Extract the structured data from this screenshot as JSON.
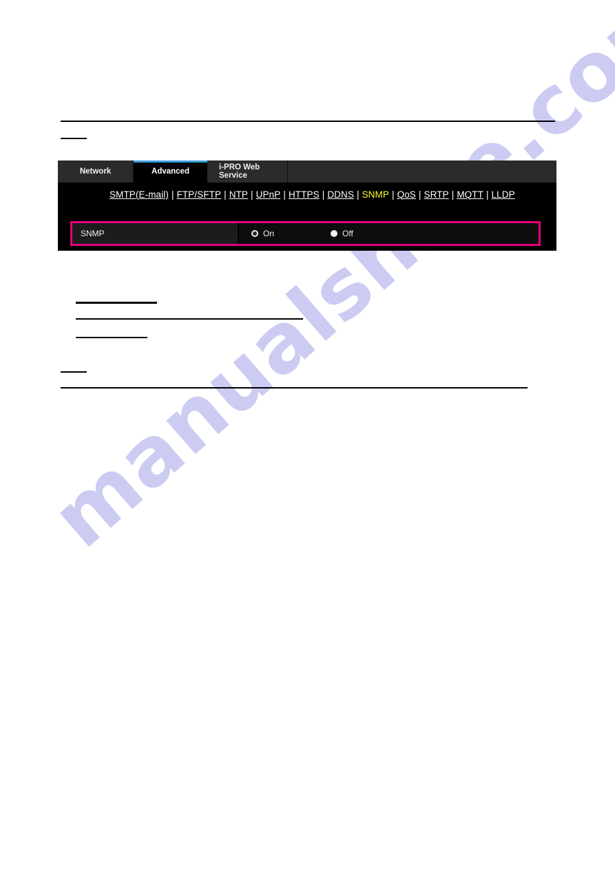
{
  "document": {
    "background": "#ffffff",
    "watermark": "manualshive.com",
    "watermark_color": "#ccccf2"
  },
  "panel": {
    "background": "#000000",
    "accent_active_tab": "#3a9fe0",
    "highlight_color": "#e6007e",
    "tabs": [
      {
        "label": "Network",
        "active": false
      },
      {
        "label": "Advanced",
        "active": true
      },
      {
        "label": "i-PRO Web Service",
        "active": false
      }
    ],
    "subnav": {
      "separator": "|",
      "links": [
        {
          "label": "SMTP(E-mail)",
          "current": false
        },
        {
          "label": "FTP/SFTP",
          "current": false
        },
        {
          "label": "NTP",
          "current": false
        },
        {
          "label": "UPnP",
          "current": false
        },
        {
          "label": "HTTPS",
          "current": false
        },
        {
          "label": "DDNS",
          "current": false
        },
        {
          "label": "SNMP",
          "current": true
        },
        {
          "label": "QoS",
          "current": false
        },
        {
          "label": "SRTP",
          "current": false
        },
        {
          "label": "MQTT",
          "current": false
        },
        {
          "label": "LLDP",
          "current": false
        }
      ],
      "current_color": "#ffff33"
    },
    "setting_row": {
      "label": "SNMP",
      "options": [
        {
          "label": "On",
          "selected": true
        },
        {
          "label": "Off",
          "selected": false
        }
      ]
    }
  }
}
